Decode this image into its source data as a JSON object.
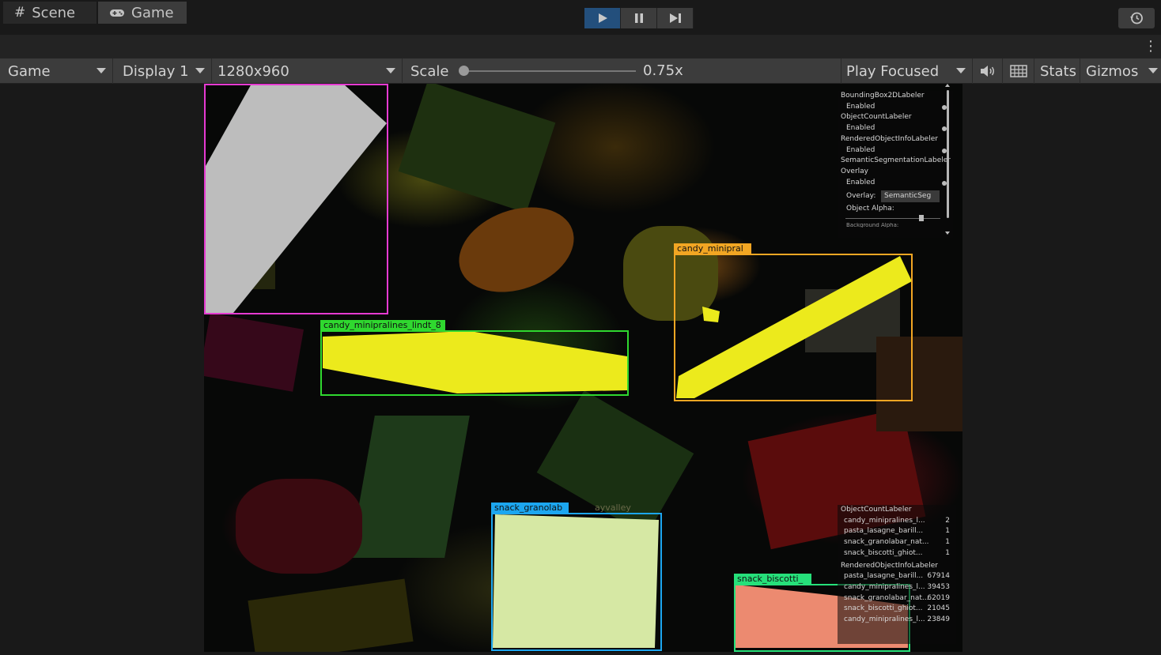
{
  "toolbar": {
    "play_icon": "play-icon",
    "pause_icon": "pause-icon",
    "step_icon": "step-icon",
    "history_icon": "history-icon"
  },
  "tabs": [
    {
      "label": "Scene",
      "icon": "grid-icon"
    },
    {
      "label": "Game",
      "icon": "gamepad-icon"
    }
  ],
  "game_toolbar": {
    "view": "Game",
    "display": "Display 1",
    "resolution": "1280x960",
    "scale_label": "Scale",
    "scale_value": "0.75x",
    "play_mode": "Play Focused",
    "stats": "Stats",
    "gizmos": "Gizmos"
  },
  "bounding_boxes": [
    {
      "label": "",
      "color": "#e63ad2"
    },
    {
      "label": "candy_minipralines_lindt_8",
      "color": "#2fd82f"
    },
    {
      "label": "candy_minipral",
      "color": "#f2a623"
    },
    {
      "label": "snack_granolab",
      "label_tail": "ayvalley",
      "color": "#1ca6f0"
    },
    {
      "label": "snack_biscotti_",
      "color": "#26e07a"
    }
  ],
  "labeler_panel": {
    "rows": [
      {
        "text": "BoundingBox2DLabeler",
        "type": "header"
      },
      {
        "text": "Enabled",
        "type": "toggle"
      },
      {
        "text": "ObjectCountLabeler",
        "type": "header"
      },
      {
        "text": "Enabled",
        "type": "toggle"
      },
      {
        "text": "RenderedObjectInfoLabeler",
        "type": "header"
      },
      {
        "text": "Enabled",
        "type": "toggle"
      },
      {
        "text": "SemanticSegmentationLabeler",
        "type": "header"
      },
      {
        "text": "Overlay",
        "type": "header"
      },
      {
        "text": "Enabled",
        "type": "toggle"
      }
    ],
    "overlay_label": "Overlay:",
    "overlay_value": "SemanticSeg",
    "object_alpha_label": "Object Alpha:",
    "cut_label": "Background Alpha:"
  },
  "count_panel": {
    "title": "ObjectCountLabeler",
    "rows": [
      {
        "name": "candy_minipralines_l...",
        "value": "2"
      },
      {
        "name": "pasta_lasagne_barill...",
        "value": "1"
      },
      {
        "name": "snack_granolabar_nat...",
        "value": "1"
      },
      {
        "name": "snack_biscotti_ghiot...",
        "value": "1"
      }
    ],
    "title2": "RenderedObjectInfoLabeler",
    "rows2": [
      {
        "name": "pasta_lasagne_barill...",
        "value": "67914"
      },
      {
        "name": "candy_minipralines_l...",
        "value": "39453"
      },
      {
        "name": "snack_granolabar_nat...",
        "value": "62019"
      },
      {
        "name": "snack_biscotti_ghiot...",
        "value": "21045"
      },
      {
        "name": "candy_minipralines_l...",
        "value": "23849"
      }
    ]
  }
}
